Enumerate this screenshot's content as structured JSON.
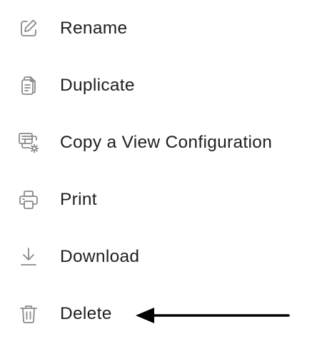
{
  "menu": {
    "items": [
      {
        "id": "rename",
        "label": "Rename",
        "icon": "edit-icon"
      },
      {
        "id": "duplicate",
        "label": "Duplicate",
        "icon": "duplicate-icon"
      },
      {
        "id": "copy_view_config",
        "label": "Copy a View Configuration",
        "icon": "copy-config-icon"
      },
      {
        "id": "print",
        "label": "Print",
        "icon": "printer-icon"
      },
      {
        "id": "download",
        "label": "Download",
        "icon": "download-icon"
      },
      {
        "id": "delete",
        "label": "Delete",
        "icon": "trash-icon"
      }
    ]
  },
  "annotation": {
    "type": "arrow",
    "points_to": "delete",
    "color": "#000000"
  },
  "colors": {
    "text": "#1f1f1f",
    "icon": "#8a8a8a",
    "background": "#ffffff"
  }
}
